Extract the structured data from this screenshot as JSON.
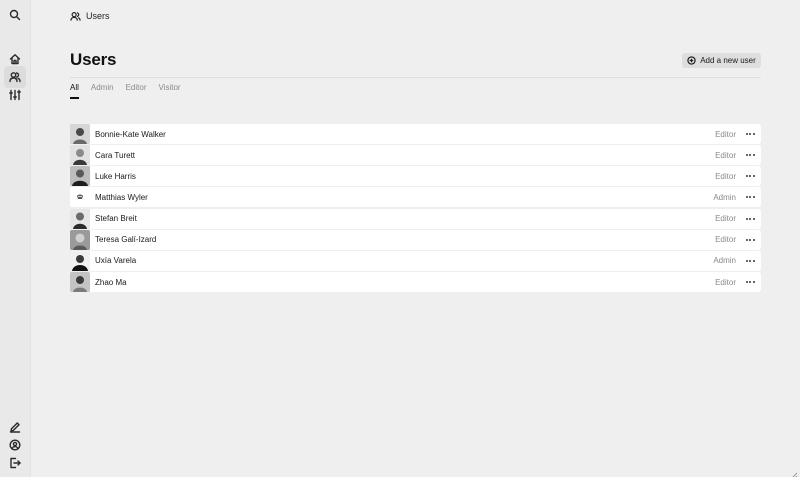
{
  "breadcrumb": {
    "label": "Users",
    "icon": "users-icon"
  },
  "page": {
    "title": "Users",
    "add_button_label": "Add a new user"
  },
  "tabs": [
    {
      "label": "All",
      "active": true
    },
    {
      "label": "Admin",
      "active": false
    },
    {
      "label": "Editor",
      "active": false
    },
    {
      "label": "Visitor",
      "active": false
    }
  ],
  "sidebar": {
    "top": [
      "search-icon",
      "home-icon",
      "users-icon",
      "sliders-icon"
    ],
    "bottom": [
      "edit-icon",
      "account-icon",
      "logout-icon"
    ]
  },
  "users": [
    {
      "name": "Bonnie-Kate Walker",
      "role": "Editor"
    },
    {
      "name": "Cara Turett",
      "role": "Editor"
    },
    {
      "name": "Luke Harris",
      "role": "Editor"
    },
    {
      "name": "Matthias Wyler",
      "role": "Admin"
    },
    {
      "name": "Stefan Breit",
      "role": "Editor"
    },
    {
      "name": "Teresa Galí-Izard",
      "role": "Editor"
    },
    {
      "name": "Uxía Varela",
      "role": "Admin"
    },
    {
      "name": "Zhao Ma",
      "role": "Editor"
    }
  ]
}
